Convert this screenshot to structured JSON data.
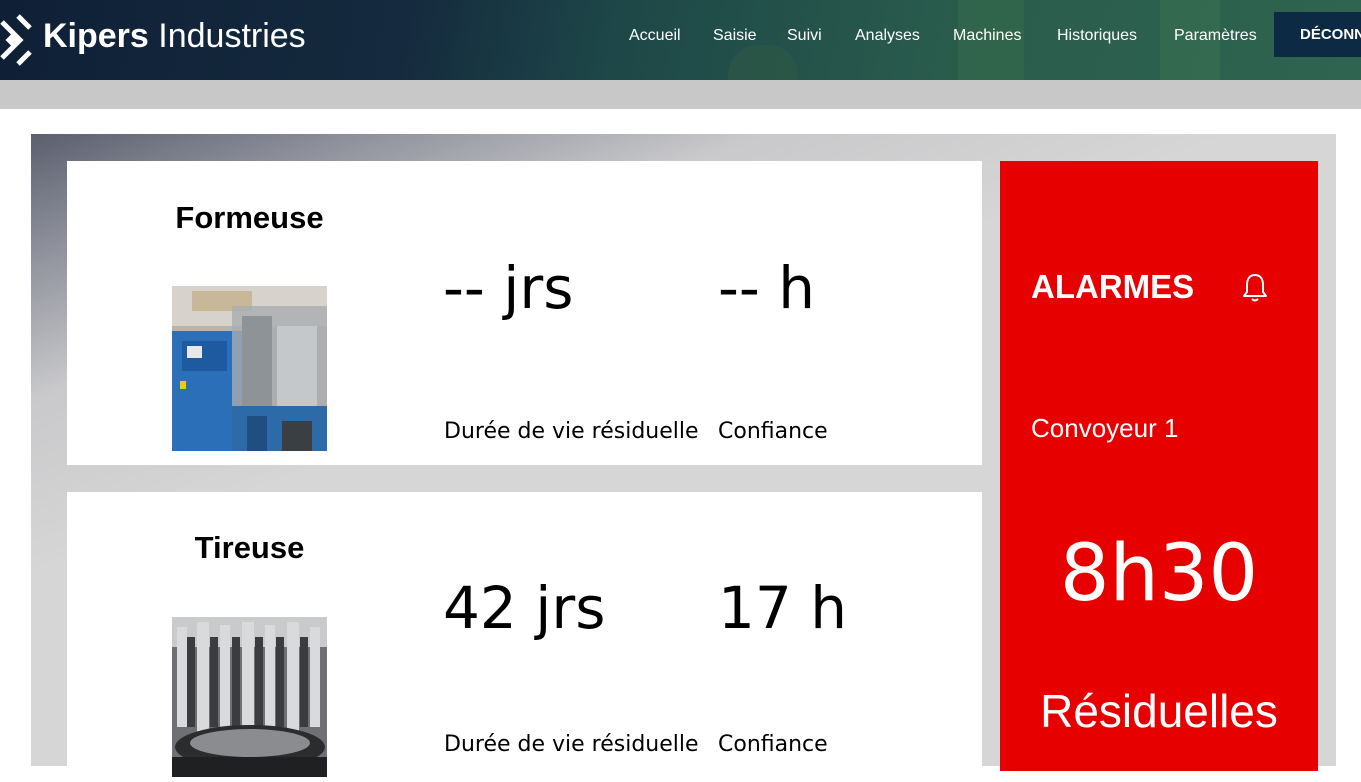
{
  "header": {
    "brand_bold": "Kipers",
    "brand_light": " Industries",
    "nav": [
      "Accueil",
      "Saisie",
      "Suivi",
      "Analyses",
      "Machines",
      "Historiques",
      "Paramètres"
    ],
    "logout_label": "DÉCONNEXION",
    "colors": {
      "background": "#152a3e",
      "logout": "#0d2a44"
    }
  },
  "machines": [
    {
      "name": "Formeuse",
      "life_value": "-- jrs",
      "life_label": "Durée de vie résiduelle",
      "confidence_value": "-- h",
      "confidence_label": "Confiance"
    },
    {
      "name": "Tireuse",
      "life_value": "42 jrs",
      "life_label": "Durée de vie résiduelle",
      "confidence_value": "17 h",
      "confidence_label": "Confiance"
    }
  ],
  "alarm": {
    "title": "ALARMES",
    "icon": "bell-icon",
    "machine": "Convoyeur 1",
    "time": "8h30",
    "unit": "Résiduelles",
    "color": "#e60000"
  }
}
